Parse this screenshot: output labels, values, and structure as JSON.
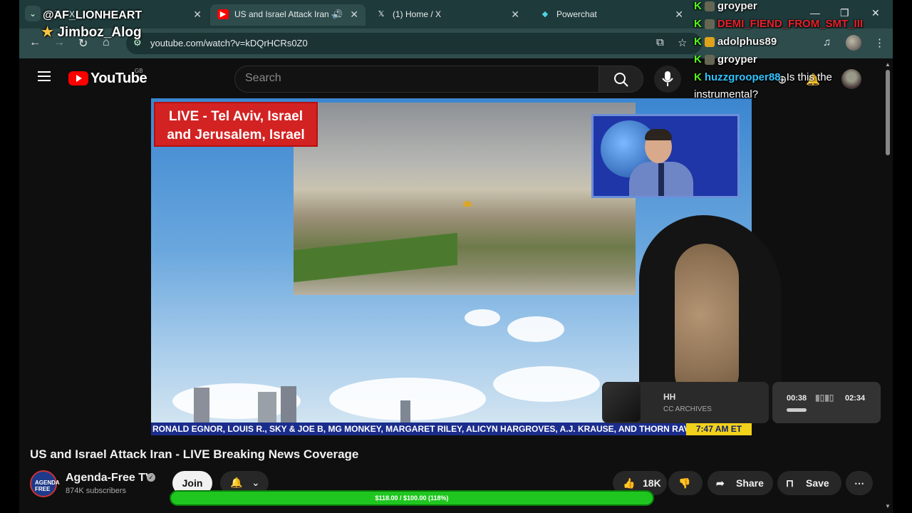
{
  "overlay": {
    "top_user_1": "@AF_LIONHEART",
    "top_user_2": "Jimboz_Alog"
  },
  "browser": {
    "tabs": [
      {
        "title": "X",
        "favicon": "x-icon"
      },
      {
        "title": "US and Israel Attack Iran - L",
        "favicon": "youtube-icon",
        "active": true
      },
      {
        "title": "(1) Home / X",
        "favicon": "x-icon"
      },
      {
        "title": "Powerchat",
        "favicon": "powerchat-icon"
      }
    ],
    "url": "youtube.com/watch?v=kDQrHCRs0Z0"
  },
  "youtube": {
    "logo_text": "YouTube",
    "country_code": "GB",
    "search_placeholder": "Search"
  },
  "video": {
    "live_label_line1": "LIVE - Tel Aviv, Israel",
    "live_label_line2": "and Jerusalem, Israel",
    "ticker_text": "RONALD EGNOR, LOUIS R., SKY & JOE B, MG MONKEY, MARGARET RILEY, ALICYN HARGROVES, A.J. KRAUSE, AND THORN RAVENS",
    "ticker_time": "7:47 AM ET",
    "title": "US and Israel Attack Iran - LIVE Breaking News Coverage"
  },
  "music_player": {
    "title": "HH",
    "subtitle": "CC ARCHIVES",
    "elapsed": "00:38",
    "duration": "02:34"
  },
  "channel": {
    "name": "Agenda-Free TV",
    "subscribers": "874K subscribers",
    "avatar_text": "AGENDA FREE"
  },
  "actions": {
    "join_label": "Join",
    "likes": "18K",
    "share_label": "Share",
    "save_label": "Save"
  },
  "goal": {
    "text": "$118.00 / $100.00 (118%)",
    "progress_percent": 118
  },
  "chat": [
    {
      "user": "groyper",
      "color": "#f0f0f0",
      "message": ""
    },
    {
      "user": "DEMI_FIEND_FROM_SMT_III",
      "color": "#e8202a",
      "message": ""
    },
    {
      "user": "adolphus89",
      "color": "#f0f0f0",
      "message": ""
    },
    {
      "user": "groyper",
      "color": "#f0f0f0",
      "message": ""
    },
    {
      "user": "huzzgrooper88",
      "color": "#2ec4ff",
      "message": "Is this the"
    },
    {
      "user": "",
      "color": "#f0f0f0",
      "message": "instrumental?"
    }
  ],
  "colors": {
    "tab_strip": "#1f3a3a",
    "toolbar": "#2e4c4c",
    "yt_red": "#ff0000",
    "kick_green": "#53fc18",
    "goal_green": "#1fc61f"
  }
}
